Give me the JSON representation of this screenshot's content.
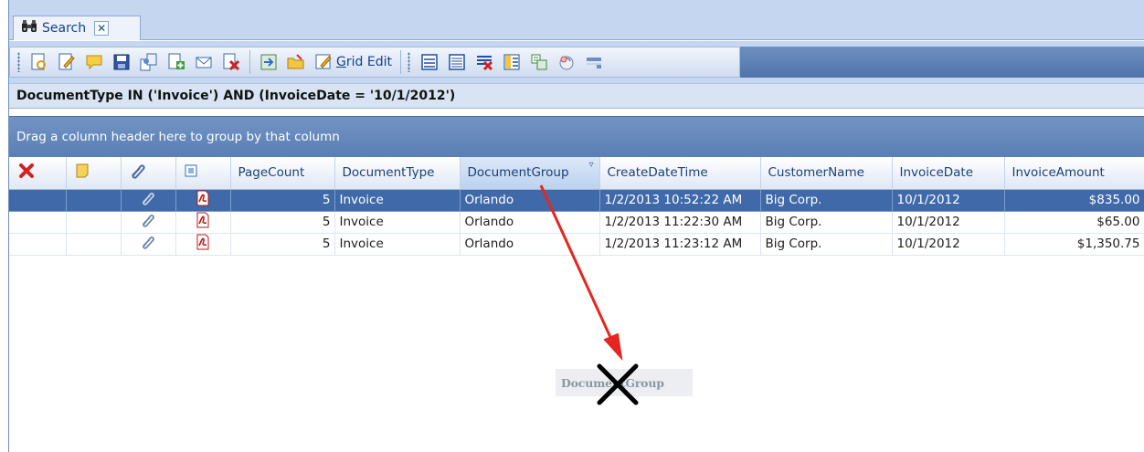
{
  "tab": {
    "label": "Search",
    "close_label": "✕"
  },
  "toolbar": {
    "grid_edit_prefix": "",
    "grid_edit_mnemonic": "G",
    "grid_edit_rest": "rid Edit"
  },
  "filter": {
    "text": "DocumentType IN ('Invoice') AND (InvoiceDate = '10/1/2012')"
  },
  "group_panel": {
    "text": "Drag a column header here to group by that column"
  },
  "grid": {
    "columns": [
      "PageCount",
      "DocumentType",
      "DocumentGroup",
      "CreateDateTime",
      "CustomerName",
      "InvoiceDate",
      "InvoiceAmount"
    ],
    "filter_indicator": "▿",
    "rows": [
      {
        "page_count": "5",
        "document_type": "Invoice",
        "document_group": "Orlando",
        "create_date_time": "1/2/2013 10:52:22 AM",
        "customer_name": "Big Corp.",
        "invoice_date": "10/1/2012",
        "invoice_amount": "$835.00"
      },
      {
        "page_count": "5",
        "document_type": "Invoice",
        "document_group": "Orlando",
        "create_date_time": "1/2/2013 11:22:30 AM",
        "customer_name": "Big Corp.",
        "invoice_date": "10/1/2012",
        "invoice_amount": "$65.00"
      },
      {
        "page_count": "5",
        "document_type": "Invoice",
        "document_group": "Orlando",
        "create_date_time": "1/2/2013 11:23:12 AM",
        "customer_name": "Big Corp.",
        "invoice_date": "10/1/2012",
        "invoice_amount": "$1,350.75"
      }
    ]
  },
  "drag_ghost": {
    "text": "DocumentGroup"
  },
  "colors": {
    "selected_row": "#3f69a8",
    "annotation_arrow": "#e52620",
    "group_panel": "#6587bb"
  }
}
